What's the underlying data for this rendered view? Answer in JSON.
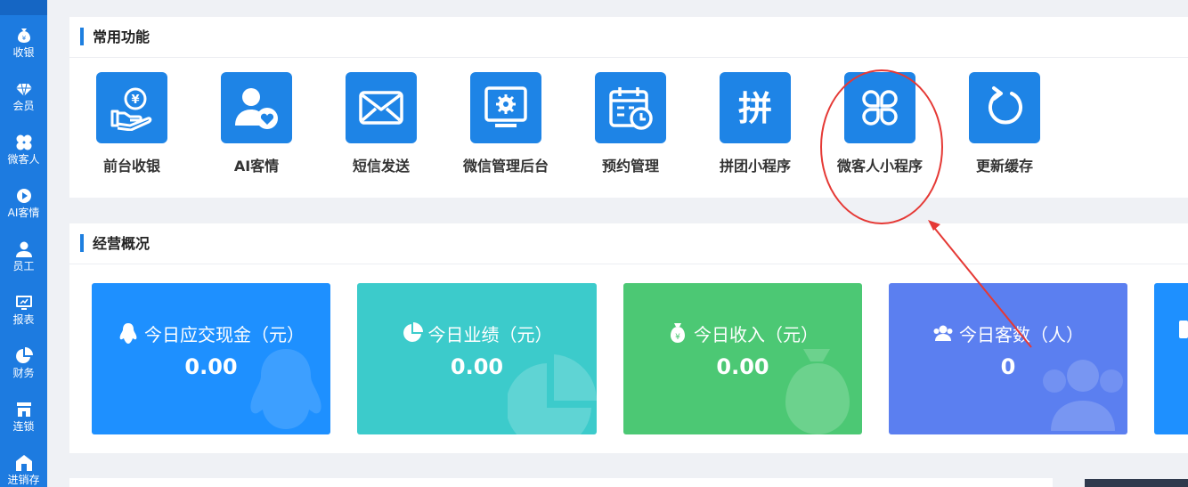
{
  "sidebar": {
    "items": [
      {
        "label": "收银",
        "icon": "money-bag-icon"
      },
      {
        "label": "会员",
        "icon": "diamond-icon"
      },
      {
        "label": "微客人",
        "icon": "clover-icon"
      },
      {
        "label": "AI客情",
        "icon": "play-icon"
      },
      {
        "label": "员工",
        "icon": "person-icon"
      },
      {
        "label": "报表",
        "icon": "monitor-icon"
      },
      {
        "label": "财务",
        "icon": "pie-chart-icon"
      },
      {
        "label": "连锁",
        "icon": "store-icon"
      },
      {
        "label": "进销存",
        "icon": "warehouse-icon"
      }
    ]
  },
  "common": {
    "title": "常用功能",
    "items": [
      {
        "label": "前台收银",
        "icon": "cash-hand-icon"
      },
      {
        "label": "AI客情",
        "icon": "user-heart-icon"
      },
      {
        "label": "短信发送",
        "icon": "envelope-icon"
      },
      {
        "label": "微信管理后台",
        "icon": "monitor-gear-icon"
      },
      {
        "label": "预约管理",
        "icon": "calendar-clock-icon"
      },
      {
        "label": "拼团小程序",
        "icon": "pin-character-icon"
      },
      {
        "label": "微客人小程序",
        "icon": "clover-icon"
      },
      {
        "label": "更新缓存",
        "icon": "refresh-icon"
      }
    ]
  },
  "overview": {
    "title": "经营概况",
    "stats": [
      {
        "title": "今日应交现金（元）",
        "value": "0.00",
        "icon": "penguin-icon",
        "color": "#1e90ff"
      },
      {
        "title": "今日业绩（元）",
        "value": "0.00",
        "icon": "pie-chart-icon",
        "color": "#3ccbcb"
      },
      {
        "title": "今日收入（元）",
        "value": "0.00",
        "icon": "money-bag-icon",
        "color": "#4cc874"
      },
      {
        "title": "今日客数（人）",
        "value": "0",
        "icon": "users-icon",
        "color": "#5b7ff0"
      }
    ]
  },
  "annotation": {
    "color": "#e53935"
  }
}
